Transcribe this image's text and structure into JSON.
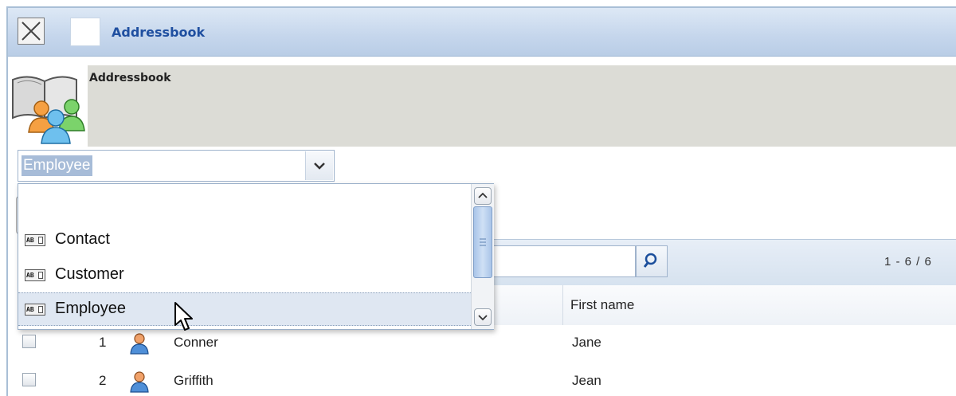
{
  "window": {
    "title": "Addressbook"
  },
  "header": {
    "title": "Addressbook"
  },
  "combo": {
    "value": "Employee"
  },
  "dropdown": {
    "items": [
      {
        "label": "Contact"
      },
      {
        "label": "Customer"
      },
      {
        "label": "Employee",
        "selected": true
      }
    ]
  },
  "grid": {
    "paging": "1 - 6 / 6",
    "columns": {
      "first_name": "First name"
    },
    "rows": [
      {
        "num": "1",
        "last": "Conner",
        "first": "Jane"
      },
      {
        "num": "2",
        "last": "Griffith",
        "first": "Jean"
      }
    ]
  },
  "icons": {
    "close": "close-icon",
    "book": "addressbook-icon",
    "person": "person-icon",
    "search": "search-icon",
    "text_type": "text-type-icon"
  }
}
